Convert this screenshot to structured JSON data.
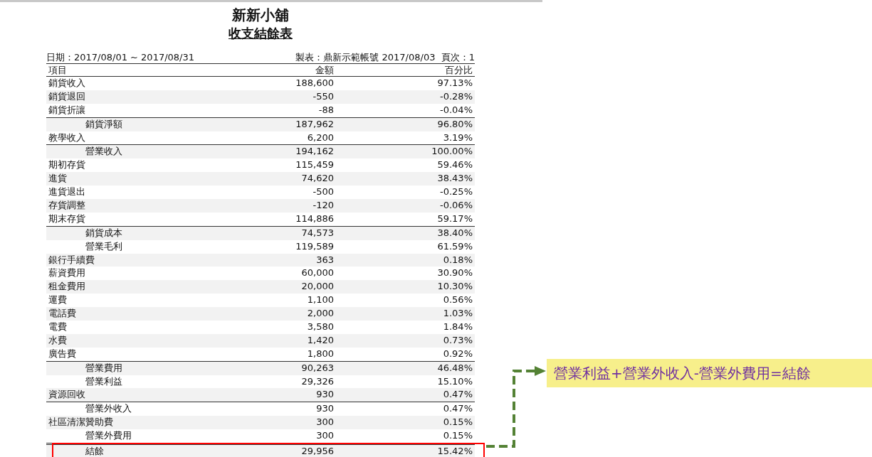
{
  "report": {
    "shop_name": "新新小舖",
    "title": "收支結餘表",
    "date_range": "日期：2017/08/01 ~ 2017/08/31",
    "prepared_by": "製表：鼎新示範帳號 2017/08/03  頁次：1"
  },
  "table": {
    "columns": [
      "項目",
      "金額",
      "百分比"
    ],
    "rows": [
      {
        "kind": "item",
        "item": "銷貨收入",
        "amount": "188,600",
        "percent": "97.13%",
        "ruled": false,
        "highlighted": false
      },
      {
        "kind": "item",
        "item": "銷貨退回",
        "amount": "-550",
        "percent": "-0.28%",
        "ruled": false,
        "highlighted": false
      },
      {
        "kind": "item",
        "item": "銷貨折讓",
        "amount": "-88",
        "percent": "-0.04%",
        "ruled": false,
        "highlighted": false
      },
      {
        "kind": "subtotal",
        "item": "銷貨淨額",
        "amount": "187,962",
        "percent": "96.80%",
        "ruled": true,
        "highlighted": false
      },
      {
        "kind": "item",
        "item": "教學收入",
        "amount": "6,200",
        "percent": "3.19%",
        "ruled": false,
        "highlighted": false
      },
      {
        "kind": "subtotal",
        "item": "營業收入",
        "amount": "194,162",
        "percent": "100.00%",
        "ruled": true,
        "highlighted": false
      },
      {
        "kind": "item",
        "item": "期初存貨",
        "amount": "115,459",
        "percent": "59.46%",
        "ruled": false,
        "highlighted": false
      },
      {
        "kind": "item",
        "item": "進貨",
        "amount": "74,620",
        "percent": "38.43%",
        "ruled": false,
        "highlighted": false
      },
      {
        "kind": "item",
        "item": "進貨退出",
        "amount": "-500",
        "percent": "-0.25%",
        "ruled": false,
        "highlighted": false
      },
      {
        "kind": "item",
        "item": "存貨調整",
        "amount": "-120",
        "percent": "-0.06%",
        "ruled": false,
        "highlighted": false
      },
      {
        "kind": "item",
        "item": "期末存貨",
        "amount": "114,886",
        "percent": "59.17%",
        "ruled": false,
        "highlighted": false
      },
      {
        "kind": "subtotal",
        "item": "銷貨成本",
        "amount": "74,573",
        "percent": "38.40%",
        "ruled": true,
        "highlighted": false
      },
      {
        "kind": "subtotal",
        "item": "營業毛利",
        "amount": "119,589",
        "percent": "61.59%",
        "ruled": false,
        "highlighted": false
      },
      {
        "kind": "item",
        "item": "銀行手續費",
        "amount": "363",
        "percent": "0.18%",
        "ruled": false,
        "highlighted": false
      },
      {
        "kind": "item",
        "item": "薪資費用",
        "amount": "60,000",
        "percent": "30.90%",
        "ruled": false,
        "highlighted": false
      },
      {
        "kind": "item",
        "item": "租金費用",
        "amount": "20,000",
        "percent": "10.30%",
        "ruled": false,
        "highlighted": false
      },
      {
        "kind": "item",
        "item": "運費",
        "amount": "1,100",
        "percent": "0.56%",
        "ruled": false,
        "highlighted": false
      },
      {
        "kind": "item",
        "item": "電話費",
        "amount": "2,000",
        "percent": "1.03%",
        "ruled": false,
        "highlighted": false
      },
      {
        "kind": "item",
        "item": "電費",
        "amount": "3,580",
        "percent": "1.84%",
        "ruled": false,
        "highlighted": false
      },
      {
        "kind": "item",
        "item": "水費",
        "amount": "1,420",
        "percent": "0.73%",
        "ruled": false,
        "highlighted": false
      },
      {
        "kind": "item",
        "item": "廣告費",
        "amount": "1,800",
        "percent": "0.92%",
        "ruled": false,
        "highlighted": false
      },
      {
        "kind": "subtotal",
        "item": "營業費用",
        "amount": "90,263",
        "percent": "46.48%",
        "ruled": true,
        "highlighted": false
      },
      {
        "kind": "subtotal",
        "item": "營業利益",
        "amount": "29,326",
        "percent": "15.10%",
        "ruled": false,
        "highlighted": false
      },
      {
        "kind": "item",
        "item": "資源回收",
        "amount": "930",
        "percent": "0.47%",
        "ruled": false,
        "highlighted": false
      },
      {
        "kind": "subtotal",
        "item": "營業外收入",
        "amount": "930",
        "percent": "0.47%",
        "ruled": true,
        "highlighted": false
      },
      {
        "kind": "item",
        "item": "社區清潔贊助費",
        "amount": "300",
        "percent": "0.15%",
        "ruled": false,
        "highlighted": false
      },
      {
        "kind": "subtotal",
        "item": "營業外費用",
        "amount": "300",
        "percent": "0.15%",
        "ruled": false,
        "highlighted": false
      },
      {
        "kind": "total",
        "item": "結餘",
        "amount": "29,956",
        "percent": "15.42%",
        "ruled": true,
        "highlighted": true
      }
    ]
  },
  "callout": {
    "text": "營業利益+營業外收入-營業外費用=結餘"
  }
}
